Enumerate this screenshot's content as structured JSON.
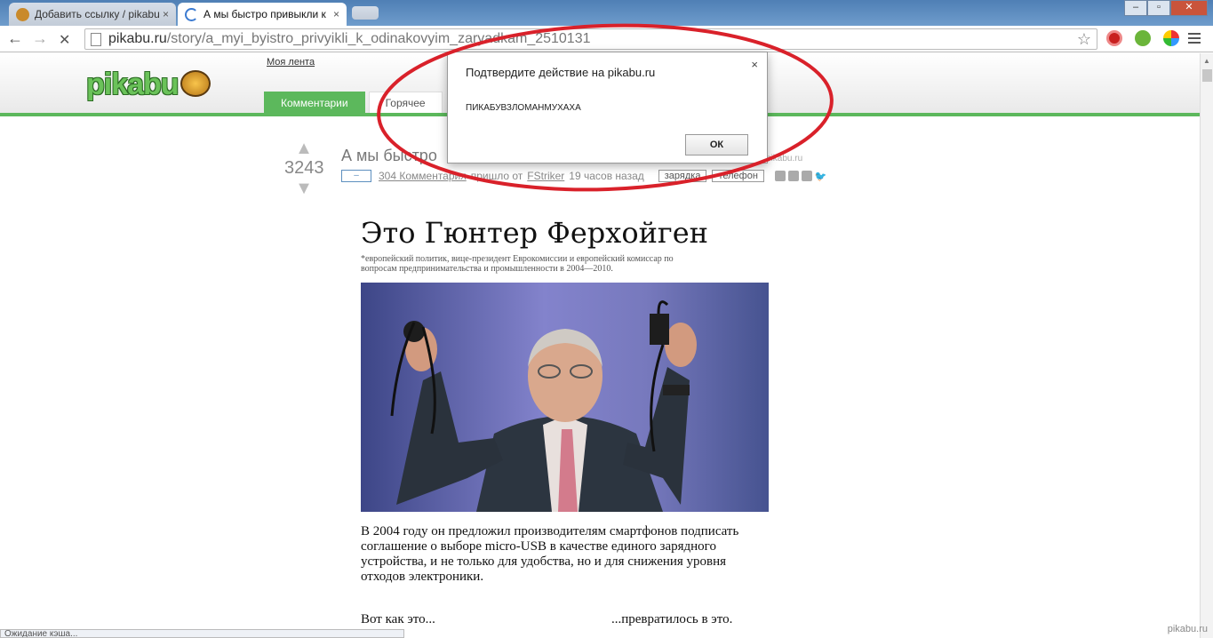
{
  "browser": {
    "tabs": [
      {
        "title": "Добавить ссылку / pikabu",
        "close": "×"
      },
      {
        "title": "А мы быстро привыкли к",
        "close": "×"
      }
    ],
    "url": "pikabu.ru/story/a_myi_byistro_privyikli_k_odinakovyim_zaryadkam_2510131",
    "url_host": "pikabu.ru",
    "url_path": "/story/a_myi_byistro_privyikli_k_odinakovyim_zaryadkam_2510131",
    "status": "Ожидание кэша..."
  },
  "site": {
    "logo": "pikabu",
    "my_feed": "Моя лента",
    "nav": [
      {
        "label": "Комментарии"
      },
      {
        "label": "Горячее"
      }
    ]
  },
  "post": {
    "score": "3243",
    "title": "А мы быстро",
    "meta": {
      "cam": "–",
      "comments": "304 Комментария",
      "came_from": "пришло от",
      "author": "FStriker",
      "time": "19 часов назад",
      "tags": [
        "зарядка",
        "телефон"
      ]
    },
    "site_link": "pikabu.ru"
  },
  "article": {
    "heading": "Это Гюнтер Ферхойген",
    "subtitle": "*европейский политик, вице-президент Еврокомиссии и европейский комиссар по вопросам предпринимательства и промышленности в 2004—2010.",
    "body": "В 2004 году он предложил производителям смартфонов подписать соглашение о выборе micro-USB в качестве единого зарядного устройства, и не только для удобства, но и для снижения уровня отходов электроники.",
    "caption_left": "Вот как это...",
    "caption_right": "...превратилось в это."
  },
  "dialog": {
    "title": "Подтвердите действие на pikabu.ru",
    "close": "×",
    "message": "ПИКАБУВЗЛОМАНМУХАХА",
    "ok": "ОК"
  },
  "watermark": "pikabu.ru",
  "colors": {
    "brand_green": "#5cb85c",
    "annotation_red": "#d9212a"
  }
}
